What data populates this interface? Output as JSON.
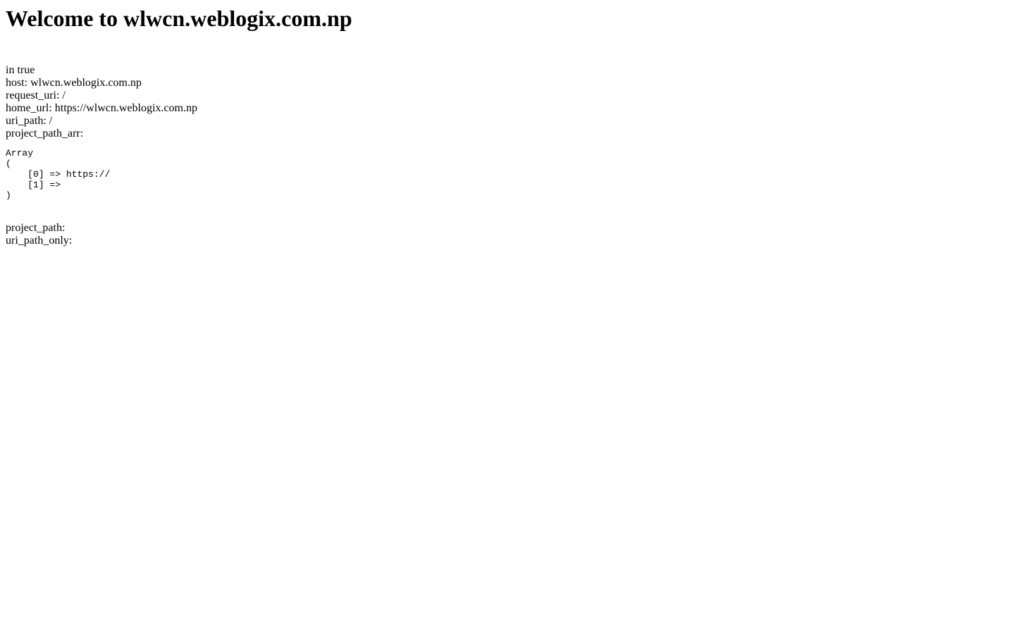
{
  "page": {
    "title": "Welcome to wlwcn.weblogix.com.np"
  },
  "info": {
    "in_line": "in true",
    "host_label": "host:",
    "host_value": "wlwcn.weblogix.com.np",
    "request_uri_label": "request_uri:",
    "request_uri_value": "/",
    "home_url_label": "home_url:",
    "home_url_value": "https://wlwcn.weblogix.com.np",
    "uri_path_label": "uri_path:",
    "uri_path_value": "/",
    "project_path_arr_label": "project_path_arr:"
  },
  "array_dump": {
    "header": "Array",
    "open": "(",
    "items": [
      {
        "key": "[0] =>",
        "value": "https://"
      },
      {
        "key": "[1] =>",
        "value": ""
      }
    ],
    "close": ")"
  },
  "footer": {
    "project_path_label": "project_path:",
    "project_path_value": "",
    "uri_path_only_label": "uri_path_only:",
    "uri_path_only_value": ""
  }
}
